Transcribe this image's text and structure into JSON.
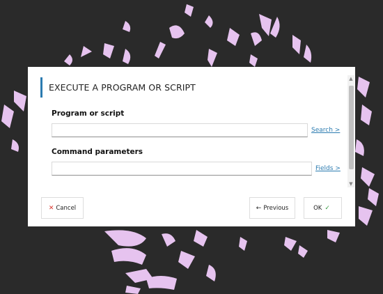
{
  "background": {
    "color": "#2a2a2a",
    "pattern_color": "#e6c3ef"
  },
  "dialog": {
    "title": "EXECUTE A PROGRAM OR SCRIPT",
    "accent_color": "#2b7bb0",
    "fields": [
      {
        "label": "Program or script",
        "value": "",
        "link": "Search >"
      },
      {
        "label": "Command parameters",
        "value": "",
        "link": "Fields >"
      }
    ],
    "scrollbar": {
      "up_icon": "chevron-up-icon",
      "down_icon": "chevron-down-icon"
    },
    "footer": {
      "cancel": {
        "icon": "close-icon",
        "icon_glyph": "✕",
        "label": "Cancel",
        "icon_color": "#d9342b"
      },
      "previous": {
        "icon": "arrow-left-icon",
        "icon_glyph": "←",
        "label": "Previous"
      },
      "ok": {
        "icon": "check-icon",
        "icon_glyph": "✓",
        "label": "OK",
        "icon_color": "#3a9a45"
      }
    }
  }
}
